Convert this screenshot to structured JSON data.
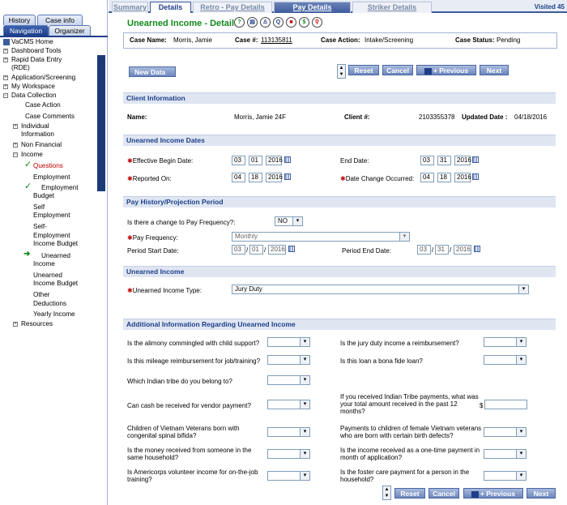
{
  "left_tabs": {
    "history": "History",
    "caseinfo": "Case info",
    "navigation": "Navigation",
    "organizer": "Organizer"
  },
  "nav": {
    "root": "VaCMS Home",
    "items": [
      "Dashboard Tools",
      "Rapid Data Entry",
      "(RDE)",
      "Application/Screening",
      "My Workspace",
      "Data Collection",
      "Case Action",
      "Case Comments",
      "Individual",
      "Information",
      "Non Financial",
      "Income",
      "Questions",
      "Employment",
      "Employment",
      "Budget",
      "Self",
      "Employment",
      "Self-",
      "Employment",
      "Income Budget",
      "Unearned",
      "Income",
      "Unearned",
      "Income Budget",
      "Other",
      "Deductions",
      "Yearly Income",
      "Resources"
    ]
  },
  "top_tabs": {
    "summary": "Summary",
    "details": "Details",
    "retro": "Retro - Pay Details",
    "pay": "Pay Details",
    "striker": "Striker Details",
    "visited": "Visited 45"
  },
  "title": "Unearned Income - Details",
  "case": {
    "name_label": "Case Name:",
    "name": "Morris, Jamie",
    "num_label": "Case #:",
    "num": "113135811",
    "action_label": "Case Action:",
    "action": "Intake/Screening",
    "status_label": "Case Status:",
    "status": "Pending"
  },
  "buttons": {
    "new_data": "New Data",
    "reset": "Reset",
    "cancel": "Cancel",
    "previous": "+ Previous",
    "next": "Next"
  },
  "sections": {
    "client": "Client Information",
    "dates": "Unearned Income Dates",
    "pay": "Pay History/Projection Period",
    "unearned": "Unearned Income",
    "additional": "Additional Information Regarding Unearned Income"
  },
  "client": {
    "name_label": "Name:",
    "name": "Morris, Jamie 24F",
    "num_label": "Client #:",
    "num": "2103355378",
    "updated_label": "Updated Date :",
    "updated": "04/18/2016"
  },
  "dates": {
    "begin_label": "Effective Begin Date:",
    "begin": [
      "03",
      "01",
      "2016"
    ],
    "end_label": "End Date:",
    "end": [
      "03",
      "31",
      "2016"
    ],
    "reported_label": "Reported On:",
    "reported": [
      "04",
      "18",
      "2016"
    ],
    "change_label": "Date Change Occurred:",
    "change": [
      "04",
      "18",
      "2016"
    ]
  },
  "pay": {
    "change_q": "Is there a change to Pay Frequency?:",
    "change_v": "NO",
    "freq_label": "Pay Frequency:",
    "freq_v": "Monthly",
    "start_label": "Period Start Date:",
    "start": [
      "03",
      "01",
      "2016"
    ],
    "end_label": "Period End Date:",
    "end": [
      "03",
      "31",
      "2016"
    ]
  },
  "unearned": {
    "type_label": "Unearned Income Type:",
    "type_v": "Jury Duty"
  },
  "questions": {
    "q1": "Is the alimony commingled with child support?",
    "q2": "Is the jury duty income a reimbursement?",
    "q3": "Is this mileage reimbursement for job/training?",
    "q4": "Is this loan a bona fide loan?",
    "q5": "Which Indian tribe do you belong to?",
    "q6": "Can cash be received for vendor payment?",
    "q7a": "If you received Indian Tribe payments, what was",
    "q7b": "your total amount received in the past 12",
    "q7c": "months?",
    "q8a": "Children of Vietnam Veterans born with",
    "q8b": "congenital spinal bifida?",
    "q9a": "Payments to children of female Vietnam veterans",
    "q9b": "who are born with certain birth defects?",
    "q10a": "Is the money received from someone in the",
    "q10b": "same household?",
    "q11a": "Is the income received as a one-time payment in",
    "q11b": "month of application?",
    "q12a": "Is Americorps volunteer income for on-the-job",
    "q12b": "training?",
    "q13a": "Is the foster care payment for a person in the",
    "q13b": "household?",
    "dollar": "$"
  },
  "icons": [
    "help-icon",
    "notes-icon",
    "person-icon",
    "query-icon",
    "stop-icon",
    "dollar-icon",
    "search-icon"
  ]
}
